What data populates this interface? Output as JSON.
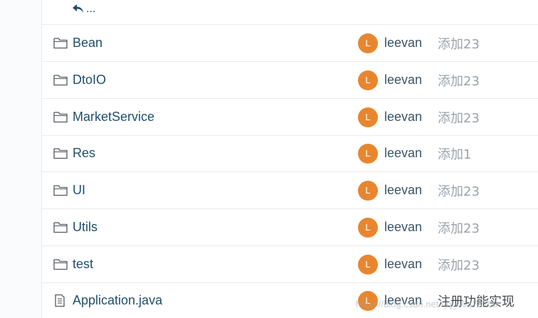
{
  "nav": {
    "up_label": "..."
  },
  "files": [
    {
      "name": "Bean",
      "type": "folder",
      "author_initial": "L",
      "author": "leevan",
      "commit": "添加23"
    },
    {
      "name": "DtoIO",
      "type": "folder",
      "author_initial": "L",
      "author": "leevan",
      "commit": "添加23"
    },
    {
      "name": "MarketService",
      "type": "folder",
      "author_initial": "L",
      "author": "leevan",
      "commit": "添加23"
    },
    {
      "name": "Res",
      "type": "folder",
      "author_initial": "L",
      "author": "leevan",
      "commit": "添加1"
    },
    {
      "name": "UI",
      "type": "folder",
      "author_initial": "L",
      "author": "leevan",
      "commit": "添加23"
    },
    {
      "name": "Utils",
      "type": "folder",
      "author_initial": "L",
      "author": "leevan",
      "commit": "添加23"
    },
    {
      "name": "test",
      "type": "folder",
      "author_initial": "L",
      "author": "leevan",
      "commit": "添加23"
    },
    {
      "name": "Application.java",
      "type": "file",
      "author_initial": "L",
      "author": "leevan",
      "commit": "注册功能实现"
    }
  ],
  "watermark": "https://blog.csdn.net/qq_40478208",
  "colors": {
    "link": "#1f4f6b",
    "avatar": "#e8862f",
    "commit_muted": "#9aa3ab"
  }
}
